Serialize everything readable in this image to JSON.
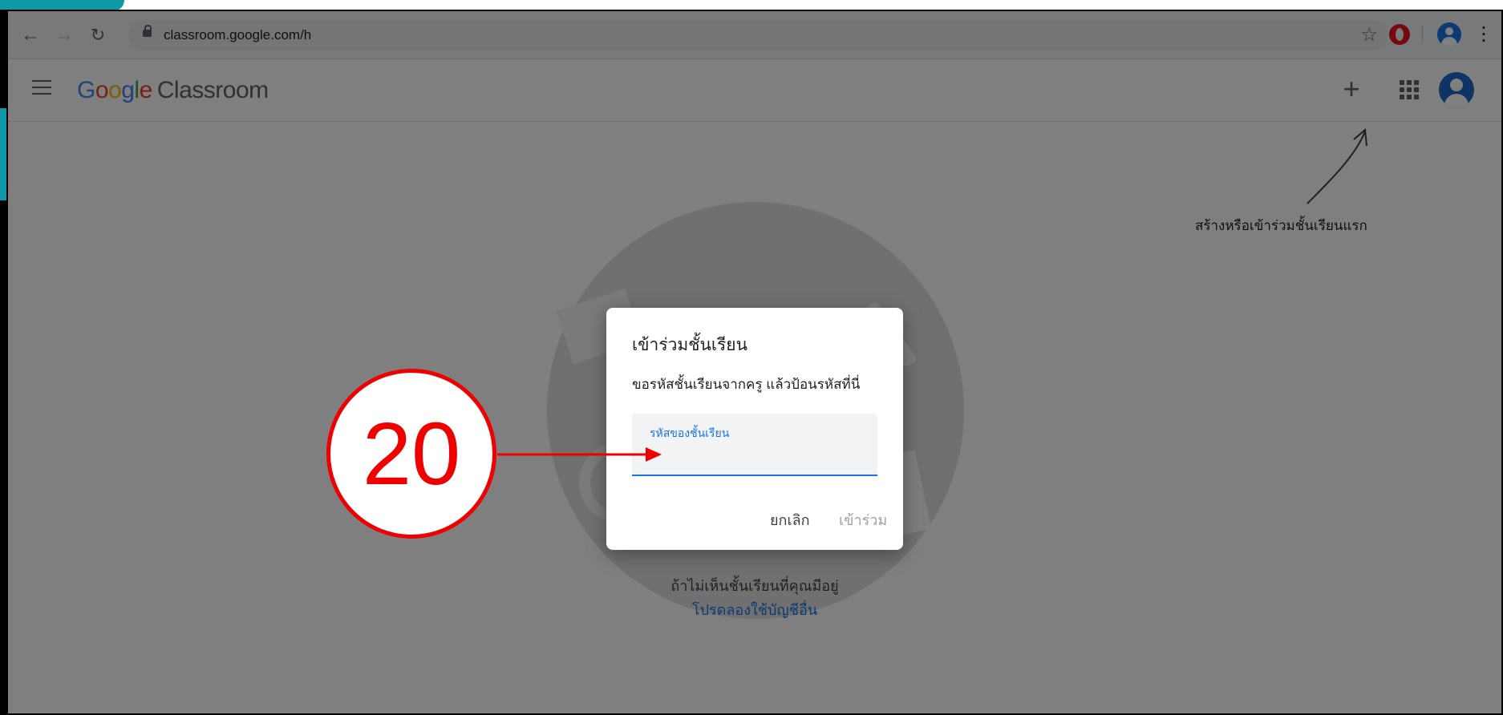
{
  "browser": {
    "url": "classroom.google.com/h",
    "back_icon": "arrow-left",
    "forward_icon": "arrow-right",
    "reload_icon": "reload",
    "star_icon": "star",
    "menu_icon": "vertical-dots"
  },
  "header": {
    "logo_google": "Google",
    "logo_product": "Classroom",
    "add_icon": "+",
    "apps_icon": "grid"
  },
  "main": {
    "hint": "สร้างหรือเข้าร่วมชั้นเรียนแรก",
    "bottom_text": "ถ้าไม่เห็นชั้นเรียนที่คุณมีอยู่",
    "bottom_link": "โปรดลองใช้บัญชีอื่น"
  },
  "dialog": {
    "title": "เข้าร่วมชั้นเรียน",
    "description": "ขอรหัสชั้นเรียนจากครู แล้วป้อนรหัสที่นี่",
    "field_label": "รหัสของชั้นเรียน",
    "field_value": "",
    "cancel": "ยกเลิก",
    "join": "เข้าร่วม"
  },
  "annotation": {
    "step_number": "20",
    "color": "#e00000"
  },
  "colors": {
    "accent": "#1a73e8",
    "teal": "#0d9aa6"
  }
}
